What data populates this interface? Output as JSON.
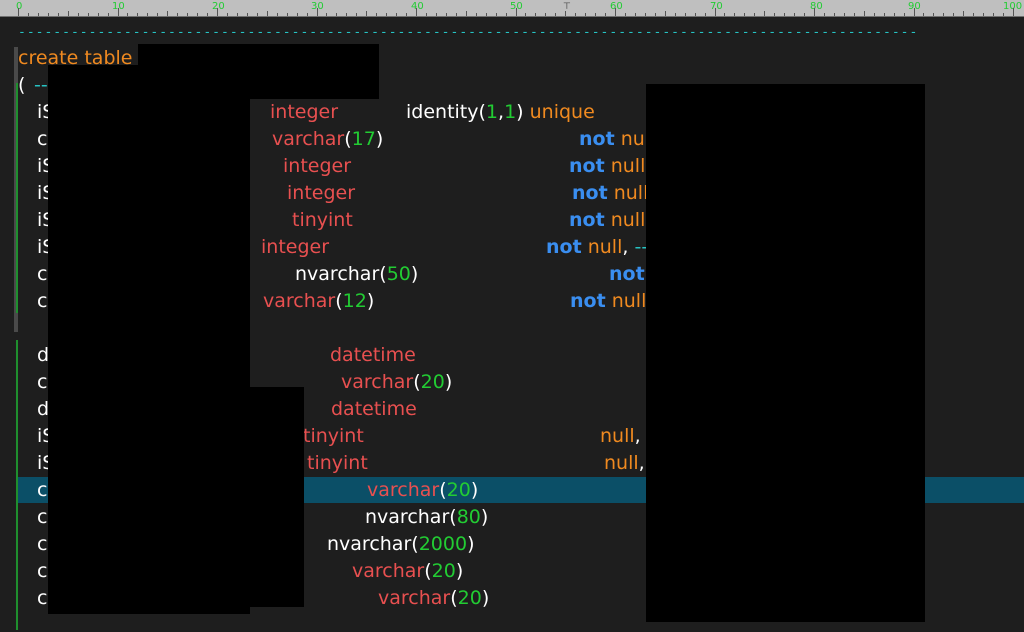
{
  "ruler": {
    "labels": [
      "0",
      "10",
      "20",
      "30",
      "40",
      "50",
      "60",
      "70",
      "80",
      "90",
      "100"
    ]
  },
  "editor": {
    "dashes": "-----------------------------------------------------------------------------------------------------------------------------------------------------------------------------",
    "create_table": "create table",
    "paren_open": "(",
    "comment_dash": "--",
    "col_prefix": {
      "c1": "iS",
      "c2": "c",
      "c3": "iS",
      "c4": "iS",
      "c5": "iS",
      "c6": "iS",
      "c7": "c",
      "c8": "c",
      "c9": "d",
      "c10": "c",
      "c11": "d",
      "c12": "iS",
      "c13": "iS",
      "c14": "c",
      "c15": "c",
      "c16": "c",
      "c17": "c",
      "c18": "c"
    },
    "types": {
      "integer": "integer",
      "varchar": "varchar",
      "nvarchar": "nvarchar",
      "tinyint": "tinyint",
      "datetime": "datetime"
    },
    "lens": {
      "l17": "17",
      "l50": "50",
      "l12": "12",
      "l20": "20",
      "l80": "80",
      "l2000": "2000"
    },
    "identity": {
      "word": "identity",
      "a": "1",
      "b": "1"
    },
    "punct": {
      "open": "(",
      "close": ")",
      "comma": ",",
      "sep": ","
    },
    "unique": "unique",
    "not_kw": "not",
    "null_kw": "null",
    "nu_part": "nu",
    "dash_comment": "--"
  },
  "colors": {
    "keyword": "#e85050",
    "number": "#22cc33",
    "not": "#3a8ef0",
    "null": "#f08a20",
    "comment": "#26c3c3",
    "highlight": "#0b4f67"
  }
}
